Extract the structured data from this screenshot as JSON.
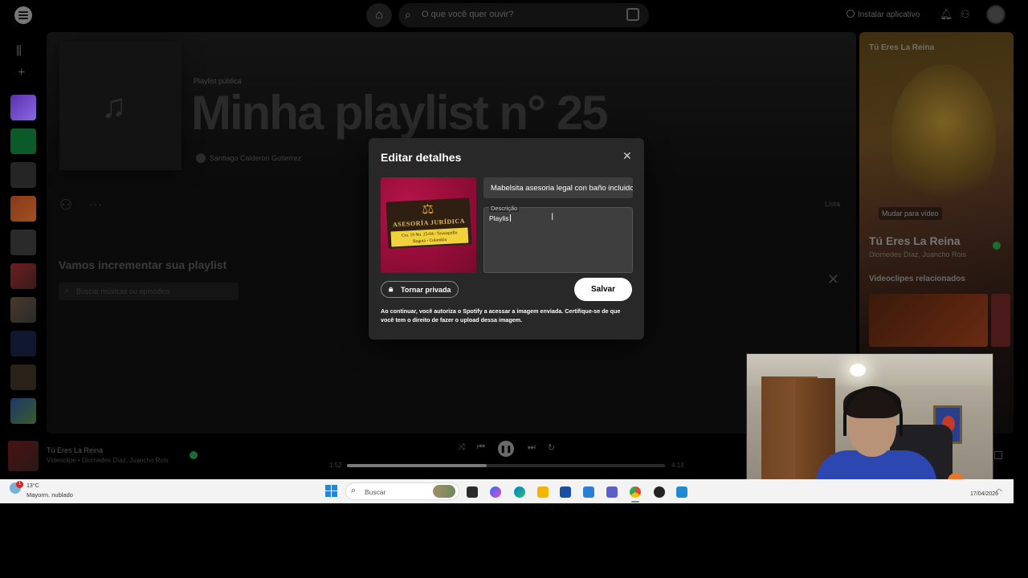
{
  "topbar": {
    "search_placeholder": "O que você quer ouvir?",
    "install_label": "Instalar aplicativo"
  },
  "playlist": {
    "type_label": "Playlist pública",
    "title": "Minha playlist n° 25",
    "owner": "Santiago Calderon Gutierrez",
    "list_label": "Lista",
    "improve_title": "Vamos incrementar sua playlist",
    "improve_search_placeholder": "Buscar músicas ou episódios"
  },
  "modal": {
    "title": "Editar detalhes",
    "name_value": "Mabelsita asesoria legal con baño incluido",
    "desc_label": "Descrição",
    "desc_value": "Playlis",
    "private_label": "Tornar privada",
    "save_label": "Salvar",
    "disclaimer": "Ao continuar, você autoriza o Spotify a acessar a imagem enviada. Certifique-se de que você tem o direito de fazer o upload dessa imagem.",
    "cover": {
      "card_name": "ASESORÍA JURÍDICA",
      "card_line1": "Cra. 19 No. 25-04 / Teusaquillo",
      "card_line2": "Bogotá - Colombia"
    }
  },
  "right_panel": {
    "header_title": "Tú Eres La Reina",
    "switch_video_label": "Mudar para vídeo",
    "song_title": "Tú Eres La Reina",
    "song_artists": "Diomedes Díaz, Juancho Rois",
    "related_title": "Videoclipes relacionados"
  },
  "player": {
    "track_title": "Tú Eres La Reina",
    "track_sub": "Videoclipe • Diomedes Díaz, Juancho Rois",
    "elapsed": "1:52",
    "duration": "4:13",
    "progress": 0.44
  },
  "taskbar": {
    "temperature": "13°C",
    "weather_desc": "Mayorm. nublado",
    "weather_badge": "1",
    "search_label": "Buscar",
    "date": "17/04/2026"
  },
  "colors": {
    "accent_green": "#1db954",
    "modal_bg": "#282828",
    "field_bg": "#3e3e3e"
  }
}
